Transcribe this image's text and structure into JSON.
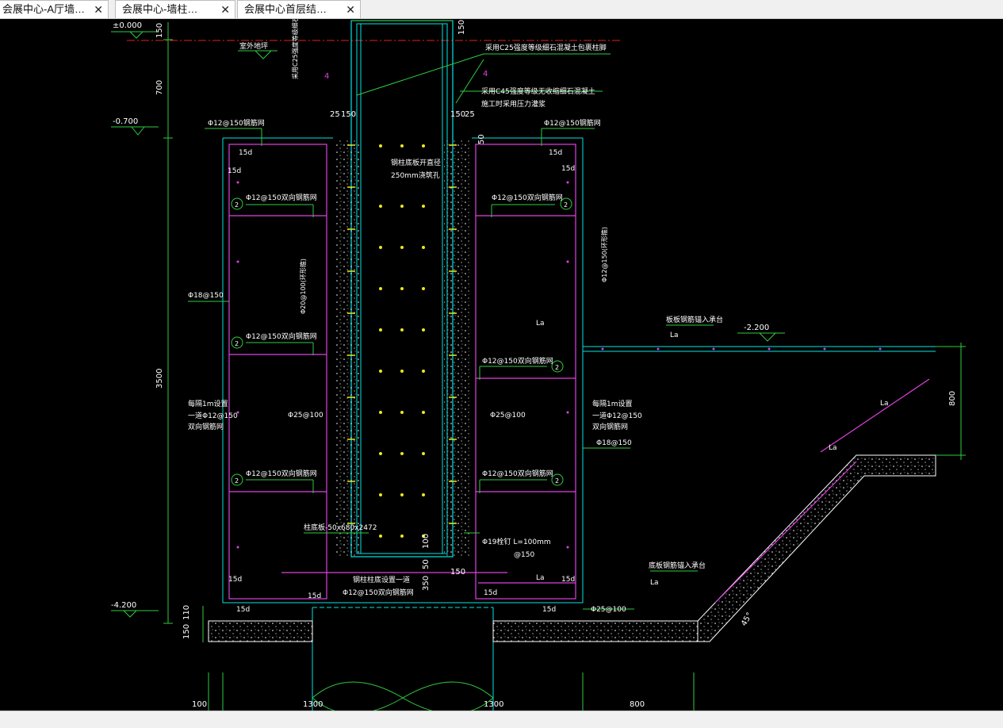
{
  "tabs": [
    {
      "label": "会展中心-A厅墙…",
      "close": "✕"
    },
    {
      "label": "会展中心-墙柱…",
      "close": "✕"
    },
    {
      "label": "会展中心首层结…",
      "close": "✕"
    }
  ],
  "drawing": {
    "elevations": {
      "e0": "±0.000",
      "e1": "-0.700",
      "e2": "-4.200",
      "e3": "-2.200"
    },
    "left_dims": {
      "d150": "150",
      "d700": "700",
      "d3500": "3500",
      "d110": "110",
      "d150b": "150"
    },
    "top_dims": {
      "d25a": "25",
      "d150a": "150",
      "d150b": "150",
      "d25b": "25",
      "d150top": "150",
      "d50": "50"
    },
    "notes": {
      "outdoor": "室外地坪",
      "c25": "采用C25强度等级细石混凝土包裹柱脚",
      "c45": "采用C45强度等级无收缩细石混凝土",
      "grout": "施工时采用压力灌浆",
      "vert_note": "采用C25强度等级细石混凝土",
      "vent_hole": "钢柱底板开直径",
      "vent_hole2": "250mm浇筑孔",
      "base_plate": "柱底板-50x680x2472",
      "stud": "Φ19栓钉 L=100mm",
      "stud_spacing": "@150",
      "col_bottom": "钢柱柱底设置一道",
      "col_bottom_mesh": "Φ12@150双向钢筋网",
      "every_1m": "每隔1m设置",
      "every_1m_b": "一道Φ12@150",
      "every_1m_c": "双向钢筋网",
      "slab_anchor": "板板钢筋锚入承台",
      "slab_anchor2": "底板钢筋锚入承台"
    },
    "rebar": {
      "mesh_top": "Φ12@150钢筋网",
      "mesh_2way": "Φ12@150双向钢筋网",
      "phi18": "Φ18@150",
      "phi20": "Φ20@100(环形箍)",
      "phi12_ring": "Φ12@150(环形箍)",
      "phi25": "Φ25@100",
      "d15": "15d",
      "la": "La",
      "circle2": "2",
      "four": "4"
    },
    "bottom_dims": {
      "b100": "100",
      "b1300a": "1300",
      "b1300b": "1300",
      "b800": "800"
    },
    "other_dims": {
      "d100": "100",
      "d50": "50",
      "d350": "350",
      "d150c": "150",
      "d800": "800",
      "d45": "45°"
    }
  },
  "colors": {
    "background": "#000000",
    "white": "#ffffff",
    "cyan": "#00e5e5",
    "green": "#2ecc40",
    "magenta": "#e040e0",
    "yellow": "#e8e820",
    "red": "#e02020"
  }
}
